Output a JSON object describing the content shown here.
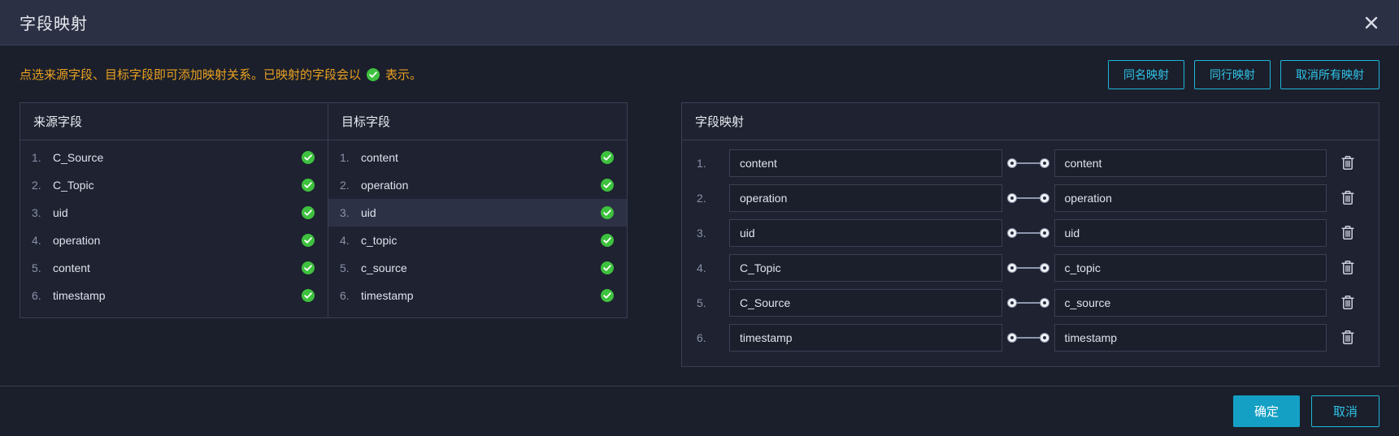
{
  "dialog": {
    "title": "字段映射",
    "close_icon": "close-icon"
  },
  "hint": {
    "text_before": "点选来源字段、目标字段即可添加映射关系。已映射的字段会以",
    "text_after": "表示。",
    "icon": "check-circle-icon",
    "color": "#e8a020"
  },
  "toolbar": {
    "buttons": [
      {
        "label": "同名映射",
        "name": "same-name-mapping-button"
      },
      {
        "label": "同行映射",
        "name": "same-row-mapping-button"
      },
      {
        "label": "取消所有映射",
        "name": "clear-all-mappings-button"
      }
    ],
    "accent_color": "#1fb5d8"
  },
  "source_panel": {
    "header": "来源字段",
    "items": [
      {
        "index": "1.",
        "name": "C_Source",
        "mapped": true,
        "selected": false
      },
      {
        "index": "2.",
        "name": "C_Topic",
        "mapped": true,
        "selected": false
      },
      {
        "index": "3.",
        "name": "uid",
        "mapped": true,
        "selected": false
      },
      {
        "index": "4.",
        "name": "operation",
        "mapped": true,
        "selected": false
      },
      {
        "index": "5.",
        "name": "content",
        "mapped": true,
        "selected": false
      },
      {
        "index": "6.",
        "name": "timestamp",
        "mapped": true,
        "selected": false
      }
    ]
  },
  "target_panel": {
    "header": "目标字段",
    "items": [
      {
        "index": "1.",
        "name": "content",
        "mapped": true,
        "selected": false
      },
      {
        "index": "2.",
        "name": "operation",
        "mapped": true,
        "selected": false
      },
      {
        "index": "3.",
        "name": "uid",
        "mapped": true,
        "selected": true
      },
      {
        "index": "4.",
        "name": "c_topic",
        "mapped": true,
        "selected": false
      },
      {
        "index": "5.",
        "name": "c_source",
        "mapped": true,
        "selected": false
      },
      {
        "index": "6.",
        "name": "timestamp",
        "mapped": true,
        "selected": false
      }
    ]
  },
  "mapping_panel": {
    "header": "字段映射",
    "delete_icon": "trash-icon",
    "connector_icon": "link-connector-icon",
    "rows": [
      {
        "index": "1.",
        "source": "content",
        "target": "content"
      },
      {
        "index": "2.",
        "source": "operation",
        "target": "operation"
      },
      {
        "index": "3.",
        "source": "uid",
        "target": "uid"
      },
      {
        "index": "4.",
        "source": "C_Topic",
        "target": "c_topic"
      },
      {
        "index": "5.",
        "source": "C_Source",
        "target": "c_source"
      },
      {
        "index": "6.",
        "source": "timestamp",
        "target": "timestamp"
      }
    ]
  },
  "footer": {
    "confirm_label": "确定",
    "cancel_label": "取消",
    "primary_color": "#13a0c4"
  },
  "colors": {
    "check_green": "#3ec13e",
    "titlebar_bg": "#2b3044",
    "dialog_bg": "#1b1f2b",
    "border": "#3a4055"
  }
}
